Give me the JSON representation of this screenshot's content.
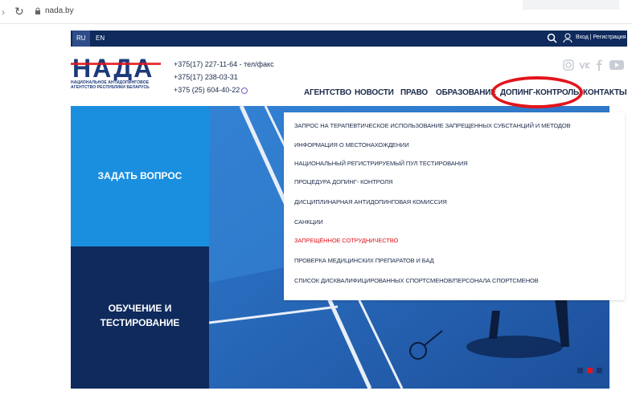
{
  "browser": {
    "url": "nada.by"
  },
  "top_strip": {
    "lang_ru": "RU",
    "lang_en": "EN",
    "login": "Вход | Регистрация"
  },
  "logo": {
    "letters": "НАДА",
    "caption_line1": "НАЦИОНАЛЬНОЕ АНТИДОПИНГОВОЕ",
    "caption_line2": "АГЕНТСТВО РЕСПУБЛИКИ БЕЛАРУСЬ"
  },
  "phones": {
    "line1": "+375(17) 227-11-64 - тел/факс",
    "line2": "+375(17) 238-03-31",
    "line3": "+375 (25) 604-40-22"
  },
  "socials": [
    "instagram-icon",
    "vk-icon",
    "facebook-icon",
    "youtube-icon"
  ],
  "nav": {
    "items": [
      "АГЕНТСТВО",
      "НОВОСТИ",
      "ПРАВО",
      "ОБРАЗОВАНИЕ",
      "ДОПИНГ-КОНТРОЛЬ",
      "КОНТАКТЫ"
    ],
    "highlighted": "ДОПИНГ-КОНТРОЛЬ"
  },
  "tiles": {
    "ask": "ЗАДАТЬ ВОПРОС",
    "train_line1": "ОБУЧЕНИЕ И",
    "train_line2": "ТЕСТИРОВАНИЕ"
  },
  "dropdown": {
    "items": [
      "ЗАПРОС НА ТЕРАПЕВТИЧЕСКОЕ ИСПОЛЬЗОВАНИЕ ЗАПРЕЩЕННЫХ СУБСТАНЦИЙ И МЕТОДОВ",
      "ИНФОРМАЦИЯ О МЕСТОНАХОЖДЕНИИ",
      "НАЦИОНАЛЬНЫЙ РЕГИСТРИРУЕМЫЙ ПУЛ ТЕСТИРОВАНИЯ",
      "ПРОЦЕДУРА ДОПИНГ- КОНТРОЛЯ",
      "ДИСЦИПЛИНАРНАЯ АНТИДОПИНГОВАЯ КОМИССИЯ",
      "САНКЦИИ",
      "ЗАПРЕЩЁННОЕ СОТРУДНИЧЕСТВО",
      "ПРОВЕРКА МЕДИЦИНСКИХ ПРЕПАРАТОВ И БАД",
      "СПИСОК ДИСКВАЛИФИЦИРОВАННЫХ СПОРТСМЕНОВ/ПЕРСОНАЛА СПОРТСМЕНОВ"
    ],
    "active_index": 6
  },
  "colors": {
    "navy": "#0f2a5c",
    "light_blue": "#1a8fe0",
    "accent_red": "#e3141b"
  }
}
